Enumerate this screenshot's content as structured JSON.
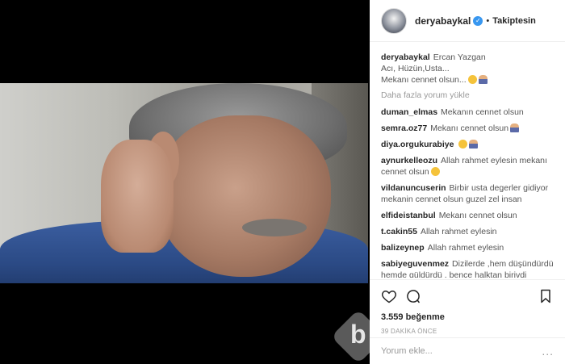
{
  "header": {
    "username": "deryabaykal",
    "separator": "•",
    "follow_status": "Takiptesin"
  },
  "caption": {
    "username": "deryabaykal",
    "line1": "Ercan Yazgan",
    "line2": "Acı, Hüzün,Usta...",
    "line3": "Mekanı cennet olsun..."
  },
  "load_more": "Daha fazla yorum yükle",
  "comments": [
    {
      "user": "duman_elmas",
      "text": "Mekanın cennet olsun"
    },
    {
      "user": "semra.oz77",
      "text": "Mekanı cennet olsun"
    },
    {
      "user": "diya.orgukurabiye",
      "text": ""
    },
    {
      "user": "aynurkelleozu",
      "text": "Allah rahmet eylesin mekanı cennet olsun"
    },
    {
      "user": "vildanuncuserin",
      "text": "Birbir usta degerler gidiyor mekanin cennet olsun guzel zel insan"
    },
    {
      "user": "elfideistanbul",
      "text": "Mekanı cennet olsun"
    },
    {
      "user": "t.cakin55",
      "text": "Allah rahmet eylesin"
    },
    {
      "user": "balizeynep",
      "text": "Allah rahmet eylesin"
    },
    {
      "user": "sabiyeguvenmez",
      "text": "Dizilerde ,hem düşündürdü hemde güldürdü , bence halktan birivdi Mütevazı bir insandı"
    }
  ],
  "likes": "3.559 beğenme",
  "time": "39 DAKİKA ÖNCE",
  "add_comment": {
    "placeholder": "Yorum ekle...",
    "more": "..."
  },
  "watermark": "b",
  "icons": {
    "like": "heart-icon",
    "comment": "speech-bubble-icon",
    "save": "bookmark-icon",
    "verified": "verified-badge-icon"
  },
  "colors": {
    "verified": "#3897f0",
    "muted": "#999999"
  }
}
